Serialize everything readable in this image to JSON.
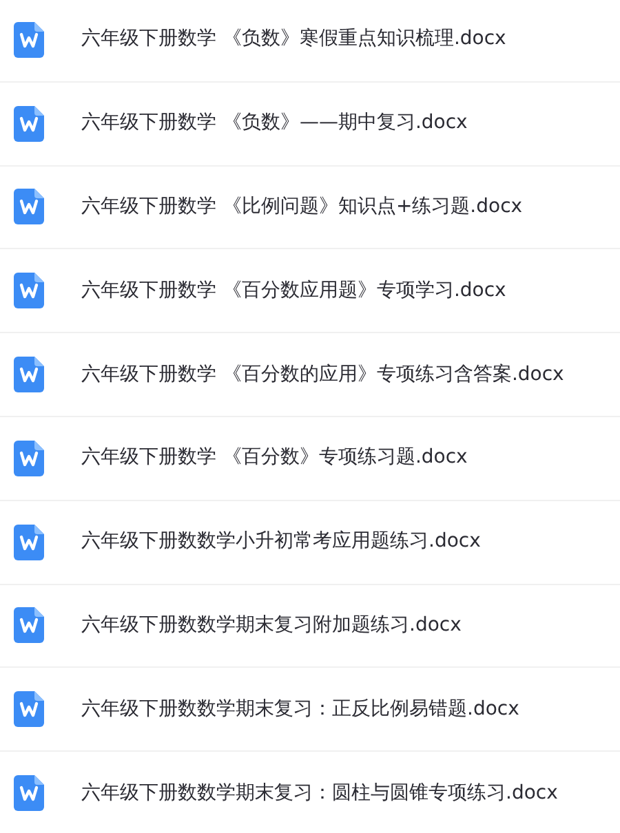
{
  "files": [
    {
      "name": "六年级下册数学 《负数》寒假重点知识梳理.docx"
    },
    {
      "name": "六年级下册数学 《负数》——期中复习.docx"
    },
    {
      "name": "六年级下册数学 《比例问题》知识点+练习题.docx"
    },
    {
      "name": "六年级下册数学 《百分数应用题》专项学习.docx"
    },
    {
      "name": "六年级下册数学 《百分数的应用》专项练习含答案.docx"
    },
    {
      "name": "六年级下册数学 《百分数》专项练习题.docx"
    },
    {
      "name": "六年级下册数数学小升初常考应用题练习.docx"
    },
    {
      "name": "六年级下册数数学期末复习附加题练习.docx"
    },
    {
      "name": "六年级下册数数学期末复习：正反比例易错题.docx"
    },
    {
      "name": "六年级下册数数学期末复习：圆柱与圆锥专项练习.docx"
    }
  ]
}
